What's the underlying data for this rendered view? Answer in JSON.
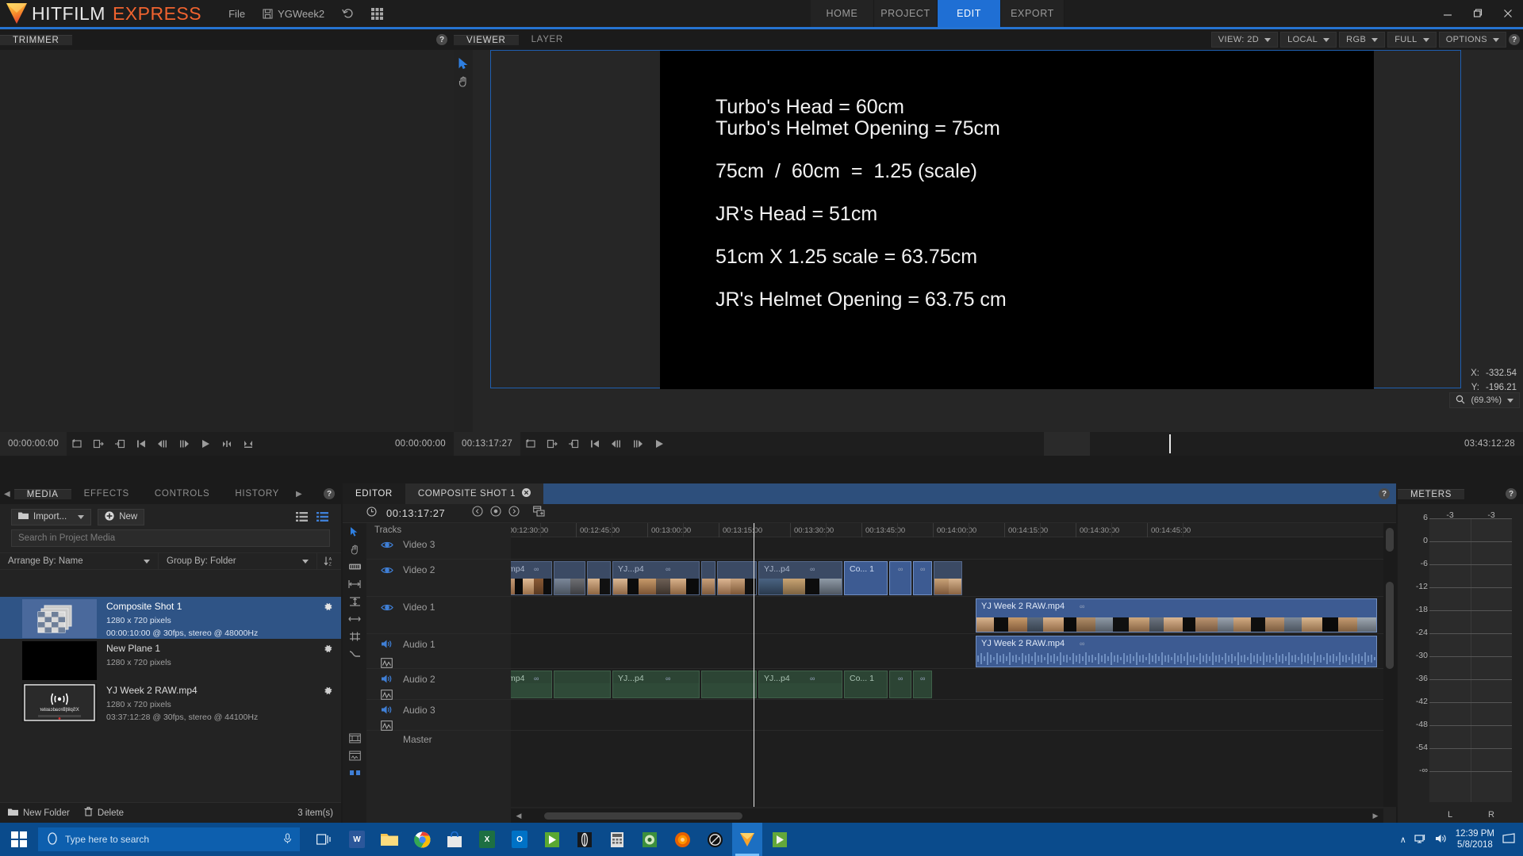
{
  "titlebar": {
    "brand_1": "HITFILM",
    "brand_2": "EXPRESS",
    "menu": [
      {
        "label": "File",
        "icon": "none"
      },
      {
        "label": "YGWeek2",
        "icon": "save-icon"
      },
      {
        "label": "",
        "icon": "undo-icon"
      },
      {
        "label": "",
        "icon": "grid-icon"
      }
    ],
    "nav_tabs": [
      {
        "label": "HOME",
        "active": false
      },
      {
        "label": "PROJECT",
        "active": false
      },
      {
        "label": "EDIT",
        "active": true
      },
      {
        "label": "EXPORT",
        "active": false
      }
    ],
    "window_controls": [
      "minimize",
      "restore",
      "close"
    ],
    "accent_color": "#2573d1"
  },
  "trimmer": {
    "tab_label": "TRIMMER",
    "timecode_left": "00:00:00:00",
    "timecode_right": "00:00:00:00"
  },
  "viewer": {
    "tabs": [
      {
        "label": "VIEWER",
        "active": true
      },
      {
        "label": "LAYER",
        "active": false
      }
    ],
    "options": [
      {
        "label": "VIEW: 2D"
      },
      {
        "label": "LOCAL"
      },
      {
        "label": "RGB"
      },
      {
        "label": "FULL"
      },
      {
        "label": "OPTIONS"
      }
    ],
    "canvas_lines": [
      "Turbo's Head = 60cm",
      "Turbo's Helmet Opening = 75cm",
      "",
      "75cm  /  60cm  =  1.25 (scale)",
      "",
      "JR's Head = 51cm",
      "",
      "51cm X 1.25 scale = 63.75cm",
      "",
      "JR's Helmet Opening = 63.75 cm"
    ],
    "coord_x_label": "X:",
    "coord_x_value": "-332.54",
    "coord_y_label": "Y:",
    "coord_y_value": "-196.21",
    "zoom_level": "(69.3%)",
    "timecode_left": "00:13:17:27",
    "timecode_right": "03:43:12:28"
  },
  "media": {
    "tabs": [
      {
        "label": "MEDIA",
        "active": true
      },
      {
        "label": "EFFECTS",
        "active": false
      },
      {
        "label": "CONTROLS",
        "active": false
      },
      {
        "label": "HISTORY",
        "active": false
      }
    ],
    "import_label": "Import...",
    "new_label": "New",
    "search_placeholder": "Search in Project Media",
    "search_value": "",
    "arrange_by": "Arrange By: Name",
    "group_by": "Group By: Folder",
    "items": [
      {
        "name": "Composite Shot 1",
        "resolution": "1280 x 720 pixels",
        "detail": "00:00:10:00 @ 30fps, stereo @ 48000Hz",
        "selected": true,
        "thumb": "composite"
      },
      {
        "name": "New Plane 1",
        "resolution": "1280 x 720 pixels",
        "detail": "",
        "selected": false,
        "thumb": "black"
      },
      {
        "name": "YJ Week 2 RAW.mp4",
        "resolution": "1280 x 720 pixels",
        "detail": "03:37:12:28 @ 30fps, stereo @ 44100Hz",
        "selected": false,
        "thumb": "broadcaster"
      }
    ],
    "new_folder_label": "New Folder",
    "delete_label": "Delete",
    "item_count": "3 item(s)"
  },
  "timeline": {
    "tabs": [
      {
        "label": "EDITOR",
        "active": true,
        "closable": false
      },
      {
        "label": "COMPOSITE SHOT 1",
        "active": false,
        "closable": true
      }
    ],
    "playhead_timecode": "00:13:17:27",
    "tracks_label": "Tracks",
    "tracks": [
      {
        "name": "Video 3",
        "type": "video"
      },
      {
        "name": "Video 2",
        "type": "video"
      },
      {
        "name": "Video 1",
        "type": "video"
      },
      {
        "name": "Audio 1",
        "type": "audio"
      },
      {
        "name": "Audio 2",
        "type": "audio"
      },
      {
        "name": "Audio 3",
        "type": "audio"
      },
      {
        "name": "Master",
        "type": "master"
      }
    ],
    "ruler_ticks": [
      "00:12:30:00",
      "00:12:45:00",
      "00:13:00:00",
      "00:13:15:00",
      "00:13:30:00",
      "00:13:45:00",
      "00:14:00:00",
      "00:14:15:00",
      "00:14:30:00",
      "00:14:45:00"
    ],
    "video2_clips": [
      {
        "label": "mp4",
        "link": true
      },
      {
        "label": "",
        "link": false
      },
      {
        "label": "YJ...p4",
        "link": true
      },
      {
        "label": "",
        "link": false
      },
      {
        "label": "YJ...p4",
        "link": true
      },
      {
        "label": "Co... 1",
        "link": true
      },
      {
        "label": "",
        "link": true
      }
    ],
    "video1_clips": [
      {
        "label": "YJ Week 2 RAW.mp4",
        "link": true
      }
    ],
    "audio1_clips": [
      {
        "label": "YJ Week 2 RAW.mp4",
        "link": true
      }
    ],
    "audio2_clips": [
      {
        "label": "mp4",
        "link": true
      },
      {
        "label": "YJ...p4",
        "link": true
      },
      {
        "label": "YJ...p4",
        "link": true
      },
      {
        "label": "Co... 1",
        "link": true
      },
      {
        "label": "",
        "link": true
      }
    ]
  },
  "meters": {
    "tab_label": "METERS",
    "peak_left": "-3",
    "peak_right": "-3",
    "scale": [
      "6",
      "0",
      "-6",
      "-12",
      "-18",
      "-24",
      "-30",
      "-36",
      "-42",
      "-48",
      "-54",
      "-∞"
    ],
    "channel_left": "L",
    "channel_right": "R"
  },
  "taskbar": {
    "search_placeholder": "Type here to search",
    "clock_time": "12:39 PM",
    "clock_date": "5/8/2018",
    "apps": [
      {
        "name": "task-view",
        "color": "#0a4b8c",
        "glyph": "▯"
      },
      {
        "name": "word",
        "color": "#2b579a",
        "glyph": "W"
      },
      {
        "name": "file-explorer",
        "color": "#f5c451",
        "glyph": ""
      },
      {
        "name": "chrome",
        "color": "#e8453c",
        "glyph": ""
      },
      {
        "name": "store",
        "color": "#e8e8e8",
        "glyph": ""
      },
      {
        "name": "excel",
        "color": "#1d6f42",
        "glyph": "X"
      },
      {
        "name": "outlook",
        "color": "#0072c6",
        "glyph": "O"
      },
      {
        "name": "app-green-1",
        "color": "#6ab023",
        "glyph": ""
      },
      {
        "name": "app-dark",
        "color": "#1a1a1a",
        "glyph": ""
      },
      {
        "name": "calculator",
        "color": "#d8d8d8",
        "glyph": ""
      },
      {
        "name": "app-green-2",
        "color": "#4caf50",
        "glyph": ""
      },
      {
        "name": "firefox",
        "color": "#e66000",
        "glyph": ""
      },
      {
        "name": "app-circle",
        "color": "#111",
        "glyph": ""
      },
      {
        "name": "hitfilm",
        "color": "#f5a623",
        "glyph": ""
      },
      {
        "name": "app-green-3",
        "color": "#63a83a",
        "glyph": ""
      }
    ]
  }
}
